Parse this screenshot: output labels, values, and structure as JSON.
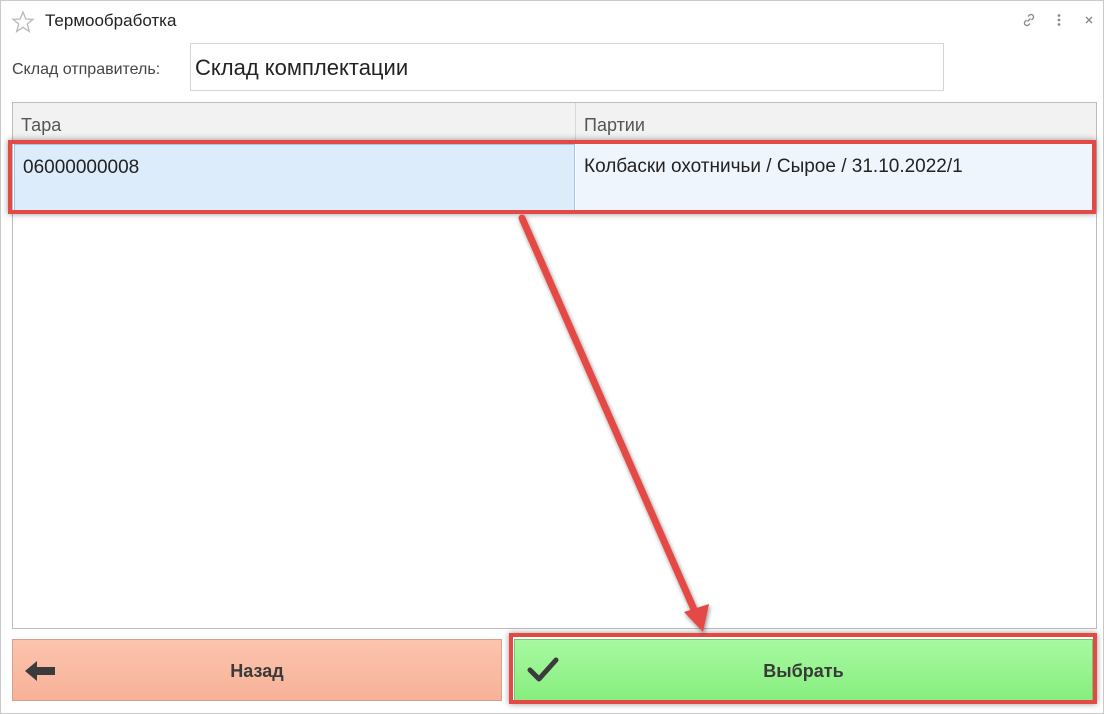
{
  "window": {
    "title": "Термообработка"
  },
  "form": {
    "warehouse_label": "Склад отправитель:",
    "warehouse_value": "Склад комплектации"
  },
  "table": {
    "columns": [
      "Тара",
      "Партии"
    ],
    "rows": [
      {
        "tara": "06000000008",
        "partii": "Колбаски охотничьи / Сырое / 31.10.2022/1"
      }
    ]
  },
  "buttons": {
    "back_label": "Назад",
    "select_label": "Выбрать"
  },
  "icons": {
    "favorite": "star-icon",
    "link": "link-icon",
    "more": "more-vertical-icon",
    "close": "close-icon",
    "back": "arrow-left-icon",
    "select": "checkmark-icon"
  },
  "colors": {
    "back_button": "#f9b9a2",
    "select_button": "#92f38a",
    "row_selected": "#dcecfb",
    "annotation_red": "#e44a45"
  }
}
